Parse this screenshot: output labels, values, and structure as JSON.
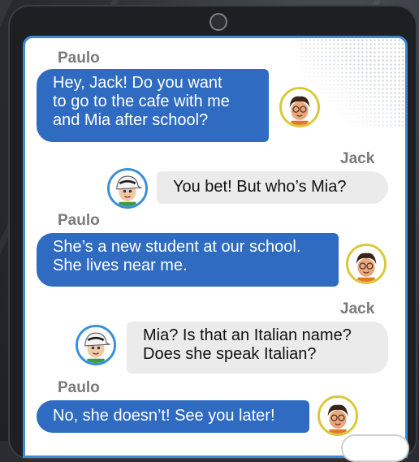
{
  "messages": [
    {
      "sender": "Paulo",
      "text_lines": [
        "Hey, Jack! Do you want",
        "to go to the cafe with me",
        "and Mia after school?"
      ],
      "avatar": "paulo-avatar-icon"
    },
    {
      "sender": "Jack",
      "text_lines": [
        "You bet! But who’s Mia?"
      ],
      "avatar": "jack-avatar-icon"
    },
    {
      "sender": "Paulo",
      "text_lines": [
        "She’s a new student at our school.",
        "She lives near me."
      ],
      "avatar": "paulo-avatar-icon"
    },
    {
      "sender": "Jack",
      "text_lines": [
        "Mia? Is that an Italian name?",
        "Does she speak Italian?"
      ],
      "avatar": "jack-avatar-icon"
    },
    {
      "sender": "Paulo",
      "text_lines": [
        "No, she doesn’t! See you later!"
      ],
      "avatar": "paulo-avatar-icon"
    }
  ],
  "colors": {
    "paulo_bubble": "#2f6bc0",
    "jack_bubble": "#ebebeb",
    "paulo_avatar_ring": "#d9c93a",
    "jack_avatar_ring": "#3b8fd6",
    "screen_border": "#3c8ad0"
  }
}
